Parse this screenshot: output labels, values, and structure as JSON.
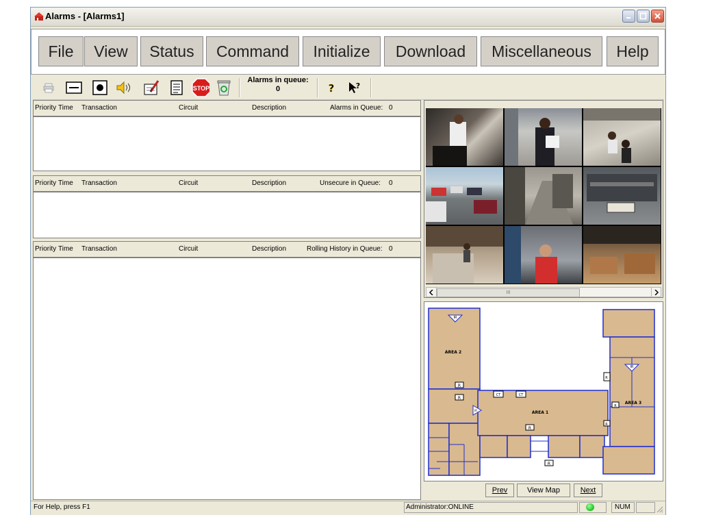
{
  "window": {
    "title": "Alarms - [Alarms1]"
  },
  "menu": [
    "File",
    "View",
    "Status",
    "Command",
    "Initialize",
    "Download",
    "Miscellaneous",
    "Help"
  ],
  "toolbar": {
    "queue_label": "Alarms in queue:",
    "queue_count": "0",
    "icons": [
      "print-icon",
      "minimize-bar-icon",
      "record-icon",
      "speaker-icon",
      "acknowledge-icon",
      "notes-icon",
      "stop-icon",
      "recycle-icon",
      "help-icon",
      "context-help-icon"
    ],
    "stop_text": "STOP",
    "help_glyph": "?",
    "context_help_glyph": "?"
  },
  "columns": {
    "priority": "Priority",
    "time": "Time",
    "transaction": "Transaction",
    "circuit": "Circuit",
    "description": "Description"
  },
  "panels": {
    "alarms": {
      "queue_label": "Alarms in Queue:",
      "count": "0"
    },
    "unsecure": {
      "queue_label": "Unsecure in Queue:",
      "count": "0"
    },
    "history": {
      "queue_label": "Rolling History in Queue:",
      "count": "0"
    }
  },
  "cameras": {
    "scroll_grip": "III"
  },
  "map": {
    "labels": {
      "area1": "AREA 1",
      "area2": "AREA 2",
      "area3": "AREA 3",
      "ir": "IR",
      "r": "R",
      "ct": "CT"
    },
    "nav": {
      "prev": "Prev",
      "view_map": "View Map",
      "next": "Next"
    }
  },
  "status": {
    "help": "For Help, press F1",
    "user": "Administrator:ONLINE",
    "num": "NUM"
  },
  "colors": {
    "map_floor": "#d9b98f",
    "map_wall": "#1f2ecf",
    "status_led": "#2ecc2e",
    "stop_red": "#d81c1c"
  }
}
